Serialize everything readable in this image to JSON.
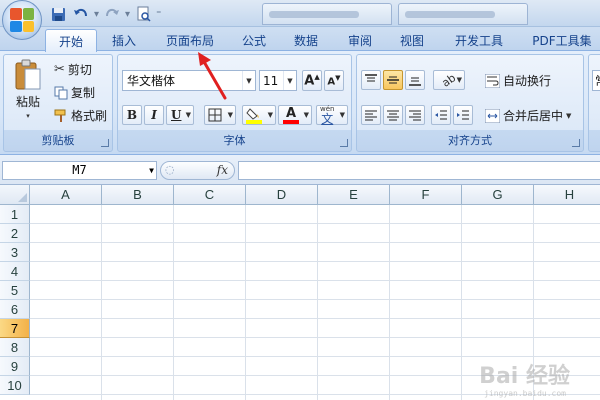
{
  "quick_access": {
    "save_icon": "save-icon",
    "undo_icon": "undo-icon",
    "redo_icon": "redo-icon",
    "preview_icon": "print-preview-icon"
  },
  "tabs": [
    {
      "label": "开始",
      "active": true
    },
    {
      "label": "插入"
    },
    {
      "label": "页面布局"
    },
    {
      "label": "公式"
    },
    {
      "label": "数据"
    },
    {
      "label": "审阅"
    },
    {
      "label": "视图"
    },
    {
      "label": "开发工具"
    },
    {
      "label": "PDF工具集"
    }
  ],
  "clipboard": {
    "paste_label": "粘贴",
    "cut_label": "剪切",
    "copy_label": "复制",
    "format_painter_label": "格式刷",
    "group_label": "剪贴板"
  },
  "font": {
    "font_name": "华文楷体",
    "font_size": "11",
    "bold_label": "B",
    "italic_label": "I",
    "underline_label": "U",
    "font_color_label": "A",
    "phonetic_label": "文",
    "phonetic_sub": "wén",
    "group_label": "字体",
    "highlight_color": "#ffff00",
    "font_color": "#ff0000"
  },
  "alignment": {
    "wrap_text_label": "自动换行",
    "merge_center_label": "合并后居中",
    "group_label": "对齐方式"
  },
  "number": {
    "format_value": "常"
  },
  "formula_bar": {
    "name_box": "M7",
    "fx_label": "fx",
    "formula": ""
  },
  "columns": [
    "A",
    "B",
    "C",
    "D",
    "E",
    "F",
    "G",
    "H"
  ],
  "rows": [
    "1",
    "2",
    "3",
    "4",
    "5",
    "6",
    "7",
    "8",
    "9",
    "10"
  ],
  "active_row": "7",
  "watermark": {
    "text": "Bai 经验",
    "sub": "jingyan.baidu.com"
  },
  "colors": {
    "accent": "#15428b",
    "annotation_arrow": "#e02020"
  }
}
